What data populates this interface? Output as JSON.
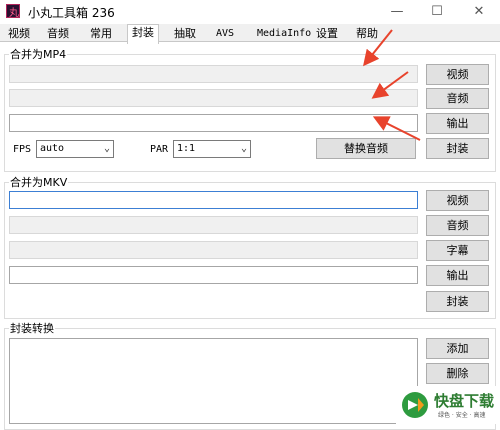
{
  "window": {
    "title": "小丸工具箱 236",
    "icon_label": "丸",
    "minimize": "—",
    "maximize": "☐",
    "close": "✕"
  },
  "tabs": [
    {
      "label": "视频"
    },
    {
      "label": "音频"
    },
    {
      "label": "常用"
    },
    {
      "label": "封装"
    },
    {
      "label": "抽取"
    },
    {
      "label": "AVS"
    },
    {
      "label": "MediaInfo"
    },
    {
      "label": "设置"
    },
    {
      "label": "帮助"
    }
  ],
  "mp4": {
    "legend": "合并为MP4",
    "video_button": "视频",
    "audio_button": "音频",
    "output_button": "输出",
    "fps_label": "FPS",
    "fps_value": "auto",
    "par_label": "PAR",
    "par_value": "1:1",
    "replace_audio_button": "替换音频",
    "mux_button": "封装"
  },
  "mkv": {
    "legend": "合并为MKV",
    "video_button": "视频",
    "audio_button": "音频",
    "subtitle_button": "字幕",
    "output_button": "输出",
    "mux_button": "封装"
  },
  "convert": {
    "legend": "封装转换",
    "add_button": "添加",
    "delete_button": "删除"
  },
  "watermark": {
    "text": "快盘下载",
    "sub": "绿色 · 安全 · 高速"
  },
  "colors": {
    "annotation_arrow": "#e8432c",
    "focus_border": "#3c7fd4"
  }
}
